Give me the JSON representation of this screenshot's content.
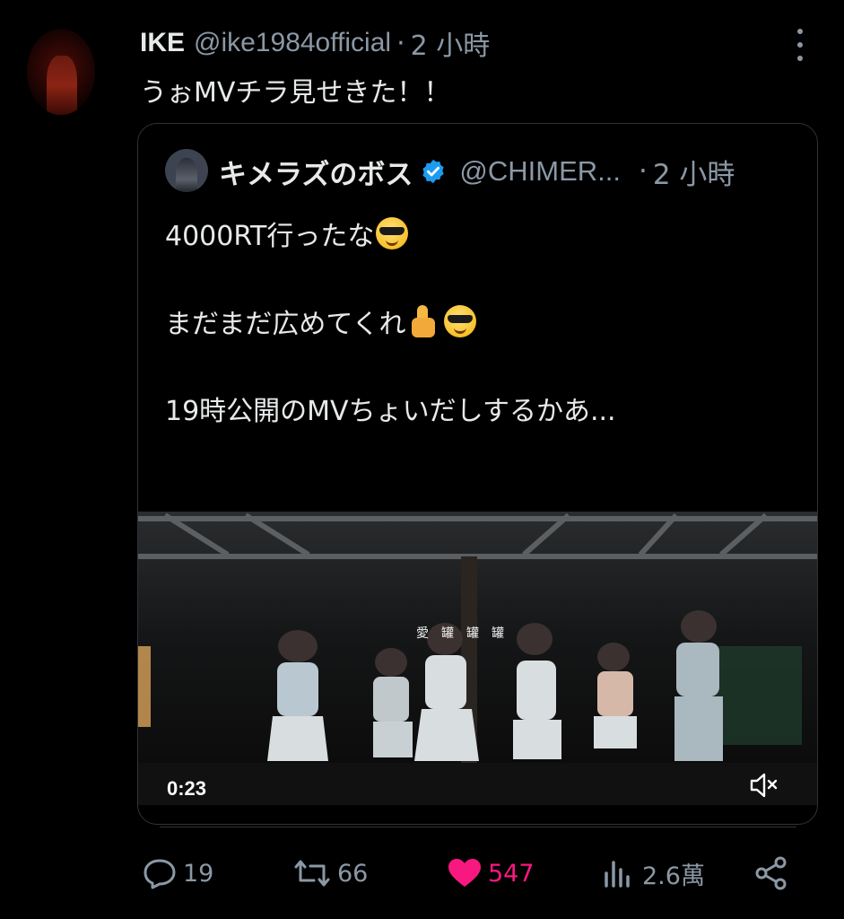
{
  "tweet": {
    "author_name": "IKE",
    "author_handle": "@ike1984official",
    "separator": "·",
    "time": "2 小時",
    "text": "うぉMVチラ見せきた！！"
  },
  "quote": {
    "author_name": "キメラズのボス",
    "author_handle": "@CHIMER...",
    "separator": "·",
    "time": "2 小時",
    "lines": [
      "4000RT行ったな",
      "まだまだ広めてくれ",
      "19時公開のMVちょいだしするかあ..."
    ],
    "video": {
      "duration": "0:23",
      "muted": true,
      "overlay_text": "愛　罐　罐　罐"
    }
  },
  "actions": {
    "replies": "19",
    "retweets": "66",
    "likes": "547",
    "views": "2.6萬"
  },
  "colors": {
    "background": "#000000",
    "text": "#e7e9ea",
    "muted": "#8b98a5",
    "like": "#f91880",
    "verified": "#1d9bf0"
  },
  "icons": [
    "more-icon",
    "verified-icon",
    "mute-icon",
    "reply-icon",
    "retweet-icon",
    "like-icon",
    "views-icon",
    "share-icon",
    "sunglasses-emoji",
    "thumbs-up-emoji"
  ]
}
